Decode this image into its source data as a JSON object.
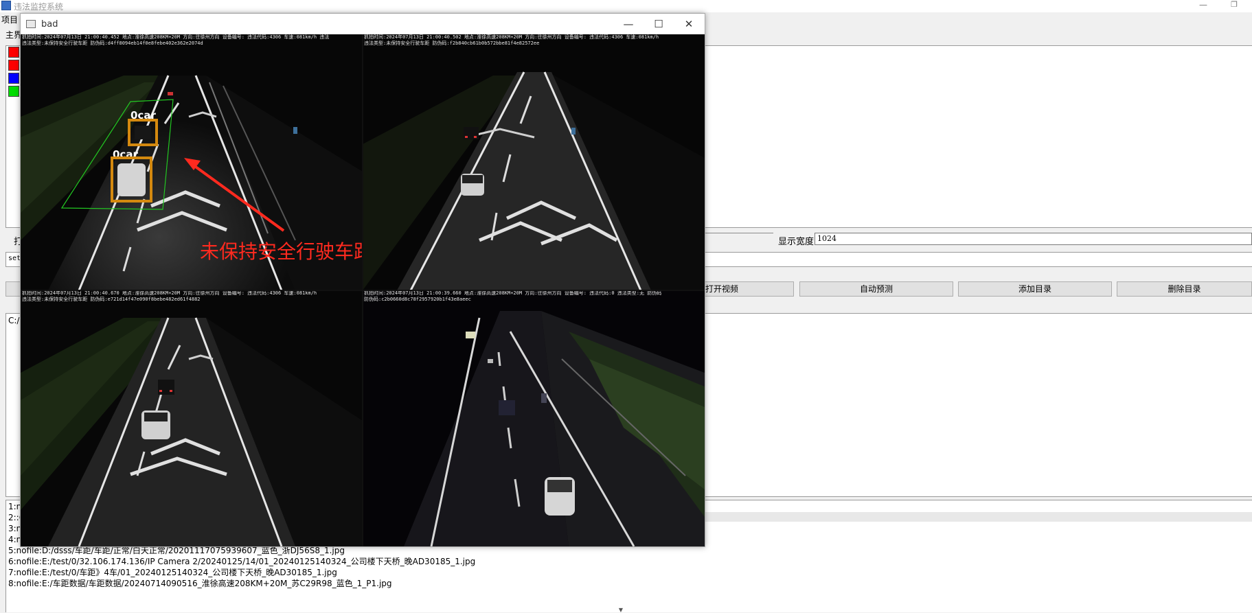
{
  "app": {
    "title": "违法监控系统",
    "menu": [
      "项目"
    ],
    "main_tab": "主界",
    "min_glyph": "—",
    "restore_glyph": "❐"
  },
  "toolbar": {
    "open_button_fragment": "打",
    "settings_input_fragment": "set",
    "display_width_label": "显示宽度",
    "display_width_value": "1024"
  },
  "buttons": {
    "open_video": "打开视频",
    "auto_predict": "自动预测",
    "add_directory": "添加目录",
    "delete_directory": "删除目录"
  },
  "directory_panel": {
    "path_fragment": "C:/"
  },
  "colors": {
    "swatch_1": "#ff0000",
    "swatch_2": "#ff0000",
    "swatch_3": "#0000ff",
    "swatch_4": "#00dd00",
    "detection_box": "#d4890f",
    "lane_region": "#22c722",
    "alert": "#ff2a1f"
  },
  "file_list": [
    "1:n",
    "2::C",
    "3:n",
    "4:n",
    "5:nofile:D:/dsss/车距/车距/正常/白天正常/20201117075939607_蓝色_浙DJ56S8_1.jpg",
    "6:nofile:E:/test/0/32.106.174.136/IP Camera 2/20240125/14/01_20240125140324_公司楼下天桥_晚AD30185_1.jpg",
    "7:nofile:E:/test/0/车距》4车/01_20240125140324_公司楼下天桥_晚AD30185_1.jpg",
    "8:nofile:E:/车距数据/车距数据/20240714090516_淮徐高速208KM+20M_苏C29R98_蓝色_1_P1.jpg"
  ],
  "window": {
    "title": "bad",
    "minimize_glyph": "—",
    "maximize_glyph": "☐",
    "close_glyph": "✕"
  },
  "video": {
    "osd": [
      {
        "line1": "抓拍时间:2024年07月13日 21:00:40.452  地点:淮徐高速208KM+20M  方向:往徐州方向  设备编号:  违法代码:4306  车速:081km/h  违法",
        "line2": "违法类型:未保持安全行驶车距  防伪码:d4ff8094eb14f0e8febe402e362e2074d"
      },
      {
        "line1": "抓拍时间:2024年07月13日 21:00:40.502  地点:淮徐高速208KM+20M  方向:往徐州方向  设备编号:  违法代码:4306  车速:081km/h",
        "line2": "违法类型:未保持安全行驶车距  防伪码:f2b840cb61b0b572bbe81f4e82572ee"
      },
      {
        "line1": "抓拍时间:2024年07月13日 21:00:40.670  地点:淮徐高速208KM+20M  方向:往徐州方向  设备编号:  违法代码:4306  车速:081km/h",
        "line2": "违法类型:未保持安全行驶车距  防伪码:e721d14f47e090f8bebe482ed61f4882"
      },
      {
        "line1": "抓拍时间:2024年07月13日 21:00:39.660  地点:淮徐高速208KM+20M  方向:往徐州方向  设备编号:  违法代码:0  违法类型:无  防伪码",
        "line2": "防伪码:c2b0660d8c78f2957920b1f43e8aeec"
      }
    ],
    "detections": [
      "0car",
      "0car"
    ],
    "alert": "未保持安全行驶车距"
  }
}
